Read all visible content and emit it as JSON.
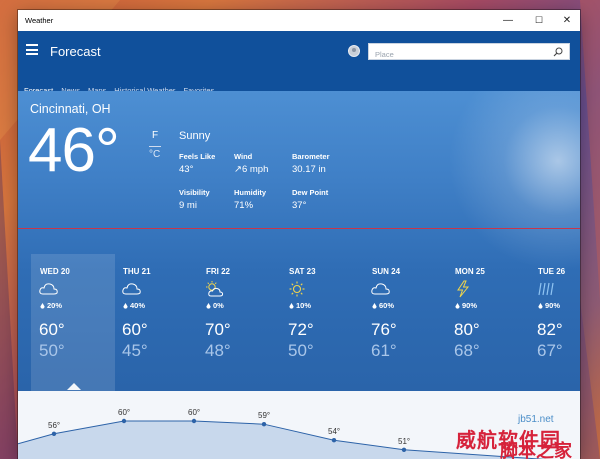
{
  "window": {
    "title": "Weather",
    "controls": {
      "minimize": "—",
      "maximize": "☐",
      "close": "✕"
    }
  },
  "appbar": {
    "title": "Forecast",
    "search_placeholder": "Place",
    "tabs": [
      {
        "label": "Forecast",
        "active": true
      },
      {
        "label": "News",
        "active": false
      },
      {
        "label": "Maps",
        "active": false
      },
      {
        "label": "Historical Weather",
        "active": false
      },
      {
        "label": "Favorites",
        "active": false
      }
    ]
  },
  "current": {
    "city": "Cincinnati, OH",
    "temp": "46°",
    "unit_f": "F",
    "unit_c": "°C",
    "condition": "Sunny",
    "stats": [
      {
        "label": "Feels Like",
        "value": "43°"
      },
      {
        "label": "Wind",
        "value": "↗6 mph"
      },
      {
        "label": "Barometer",
        "value": "30.17 in"
      },
      {
        "label": "Visibility",
        "value": "9 mi"
      },
      {
        "label": "Humidity",
        "value": "71%"
      },
      {
        "label": "Dew Point",
        "value": "37°"
      }
    ]
  },
  "forecast": [
    {
      "day": "WED 20",
      "icon": "cloudy-icon",
      "precip": "20%",
      "hi": "60°",
      "lo": "50°",
      "selected": true
    },
    {
      "day": "THU 21",
      "icon": "cloudy-icon",
      "precip": "40%",
      "hi": "60°",
      "lo": "45°",
      "selected": false
    },
    {
      "day": "FRI 22",
      "icon": "partly-sunny-icon",
      "precip": "0%",
      "hi": "70°",
      "lo": "48°",
      "selected": false
    },
    {
      "day": "SAT 23",
      "icon": "sunny-icon",
      "precip": "10%",
      "hi": "72°",
      "lo": "50°",
      "selected": false
    },
    {
      "day": "SUN 24",
      "icon": "cloudy-icon",
      "precip": "60%",
      "hi": "76°",
      "lo": "61°",
      "selected": false
    },
    {
      "day": "MON 25",
      "icon": "thunderstorm-icon",
      "precip": "90%",
      "hi": "80°",
      "lo": "68°",
      "selected": false
    },
    {
      "day": "TUE 26",
      "icon": "rain-icon",
      "precip": "90%",
      "hi": "82°",
      "lo": "67°",
      "selected": false
    }
  ],
  "hourly_chart": {
    "labels": [
      "56°",
      "60°",
      "60°",
      "59°",
      "54°",
      "51°"
    ],
    "values": [
      56,
      60,
      60,
      59,
      54,
      51
    ]
  },
  "watermark": {
    "line1": "威航软件园",
    "line2": "脚本之家",
    "line3": "jb51.net"
  },
  "colors": {
    "appbar": "#10509b",
    "hero_top": "#4d8fd3",
    "hero_bottom": "#2a64aa",
    "chart_fill": "#c8d8ec",
    "chart_line": "#2d63a8"
  }
}
